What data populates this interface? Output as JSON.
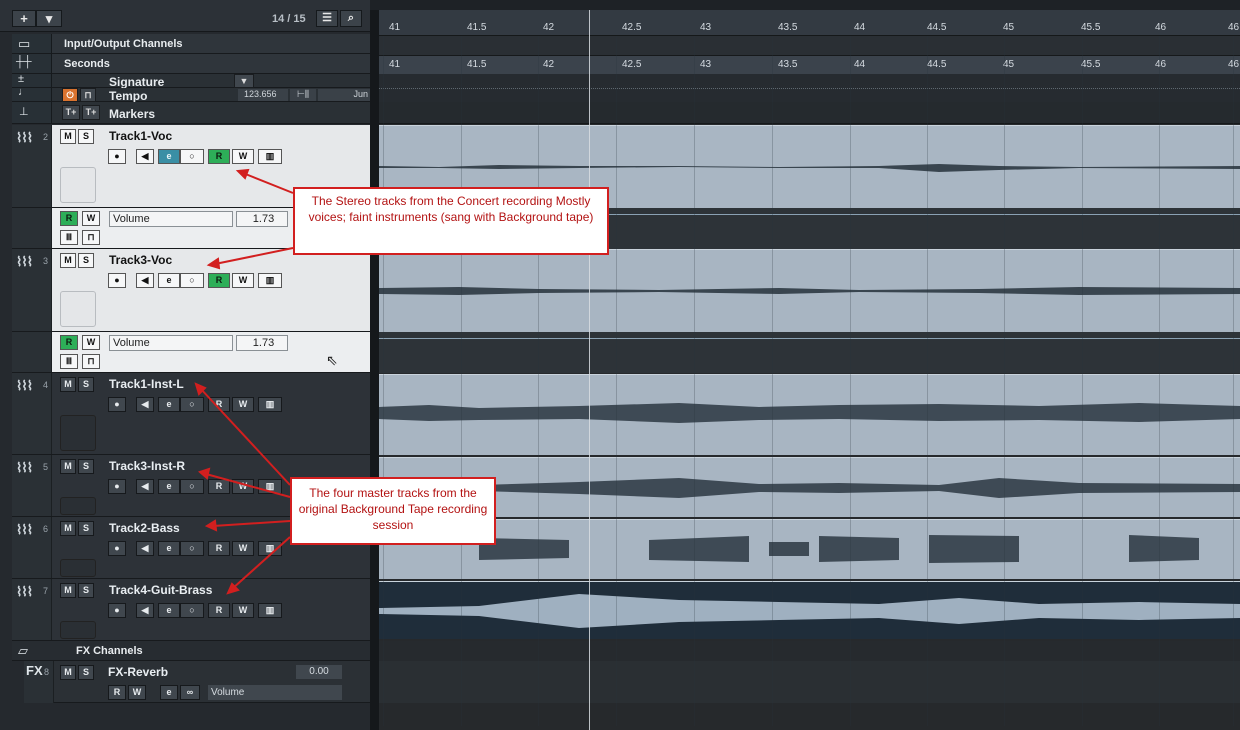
{
  "toolbar": {
    "add_label": "+",
    "track_count": "14 / 15"
  },
  "global_tracks": {
    "io": "Input/Output Channels",
    "seconds": "Seconds",
    "signature": "Signature",
    "tempo": "Tempo",
    "tempo_value": "123.656",
    "tempo_mode": "Jun",
    "markers": "Markers",
    "marker_add1": "T+",
    "marker_add2": "T+"
  },
  "ruler": {
    "labels": [
      "41",
      "41.5",
      "42",
      "42.5",
      "43",
      "43.5",
      "44",
      "44.5",
      "45",
      "45.5",
      "46",
      "46"
    ]
  },
  "tracks": [
    {
      "num": "2",
      "name": "Track1-Voc",
      "auto_param": "Volume",
      "auto_value": "1.73"
    },
    {
      "num": "3",
      "name": "Track3-Voc",
      "auto_param": "Volume",
      "auto_value": "1.73"
    },
    {
      "num": "4",
      "name": "Track1-Inst-L"
    },
    {
      "num": "5",
      "name": "Track3-Inst-R"
    },
    {
      "num": "6",
      "name": "Track2-Bass"
    },
    {
      "num": "7",
      "name": "Track4-Guit-Brass"
    }
  ],
  "fx_folder": "FX Channels",
  "fx_track": {
    "badge": "FX",
    "num": "8",
    "name": "FX-Reverb",
    "value": "0.00",
    "param": "Volume"
  },
  "buttons": {
    "m": "M",
    "s": "S",
    "r": "R",
    "w": "W"
  },
  "callouts": {
    "stereo": "The Stereo tracks from the Concert recording Mostly voices; faint instruments (sang with Background tape)",
    "master": "The four master tracks from the original Background Tape recording session"
  },
  "colors": {
    "record_green": "#2dae58",
    "edit_teal": "#3a8fa5",
    "callout_red": "#d21f1f"
  }
}
